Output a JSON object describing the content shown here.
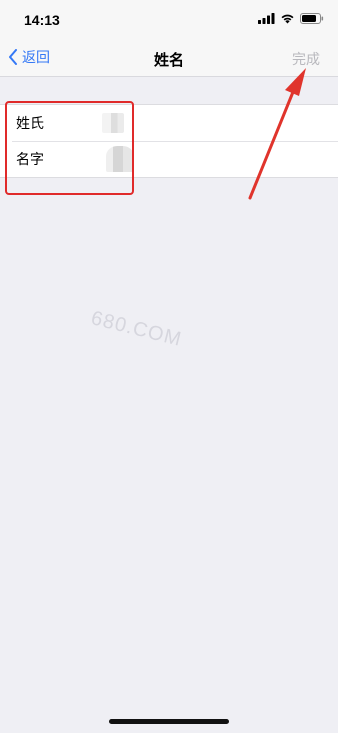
{
  "status_bar": {
    "time": "14:13"
  },
  "nav": {
    "back_label": "返回",
    "title": "姓名",
    "done_label": "完成"
  },
  "form": {
    "rows": [
      {
        "label": "姓氏"
      },
      {
        "label": "名字"
      }
    ]
  },
  "watermark": "680.COM",
  "colors": {
    "accent": "#3478f6",
    "disabled": "#b8b8bd",
    "highlight": "#e02a2a",
    "background": "#efeff4"
  },
  "icons": [
    "signal-icon",
    "wifi-icon",
    "battery-icon",
    "chevron-left-icon"
  ]
}
